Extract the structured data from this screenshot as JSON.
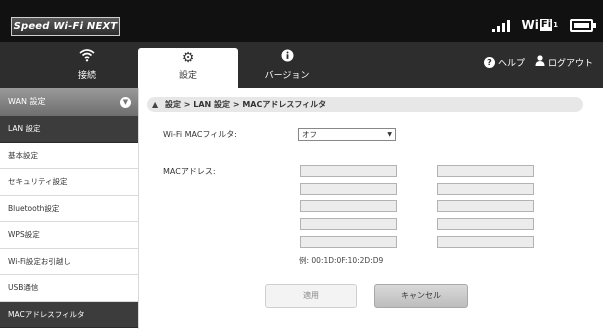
{
  "header": {
    "logo_text": "Speed Wi-Fi NEXT",
    "wifi_prefix": "Wi",
    "wifi_box": "Fi",
    "wifi_sub": "1"
  },
  "nav": {
    "tabs": [
      {
        "label": "接続",
        "icon": "wifi-icon"
      },
      {
        "label": "設定",
        "icon": "gear-icon",
        "active": true
      },
      {
        "label": "バージョン",
        "icon": "info-icon"
      }
    ],
    "help_label": "ヘルプ",
    "logout_label": "ログアウト"
  },
  "sidebar": {
    "section_label": "WAN 設定",
    "items": [
      {
        "label": "LAN 設定",
        "active": true
      },
      {
        "label": "基本設定"
      },
      {
        "label": "セキュリティ設定"
      },
      {
        "label": "Bluetooth設定"
      },
      {
        "label": "WPS設定"
      },
      {
        "label": "Wi-Fi設定お引越し"
      },
      {
        "label": "USB通信"
      },
      {
        "label": "MACアドレスフィルタ",
        "active": true
      }
    ]
  },
  "main": {
    "breadcrumb": "設定 > LAN 設定 > MACアドレスフィルタ",
    "filter_label": "Wi-Fi MACフィルタ:",
    "filter_value": "オフ",
    "mac_label": "MACアドレス:",
    "mac_addresses": [
      "",
      "",
      "",
      "",
      "",
      "",
      "",
      "",
      "",
      ""
    ],
    "example": "例: 00:1D:0F:10:2D:D9",
    "apply_label": "適用",
    "cancel_label": "キャンセル"
  },
  "colors": {
    "topbar": "#111111",
    "navbar": "#2d2d2d",
    "sidebar_active": "#3c3c3c"
  }
}
